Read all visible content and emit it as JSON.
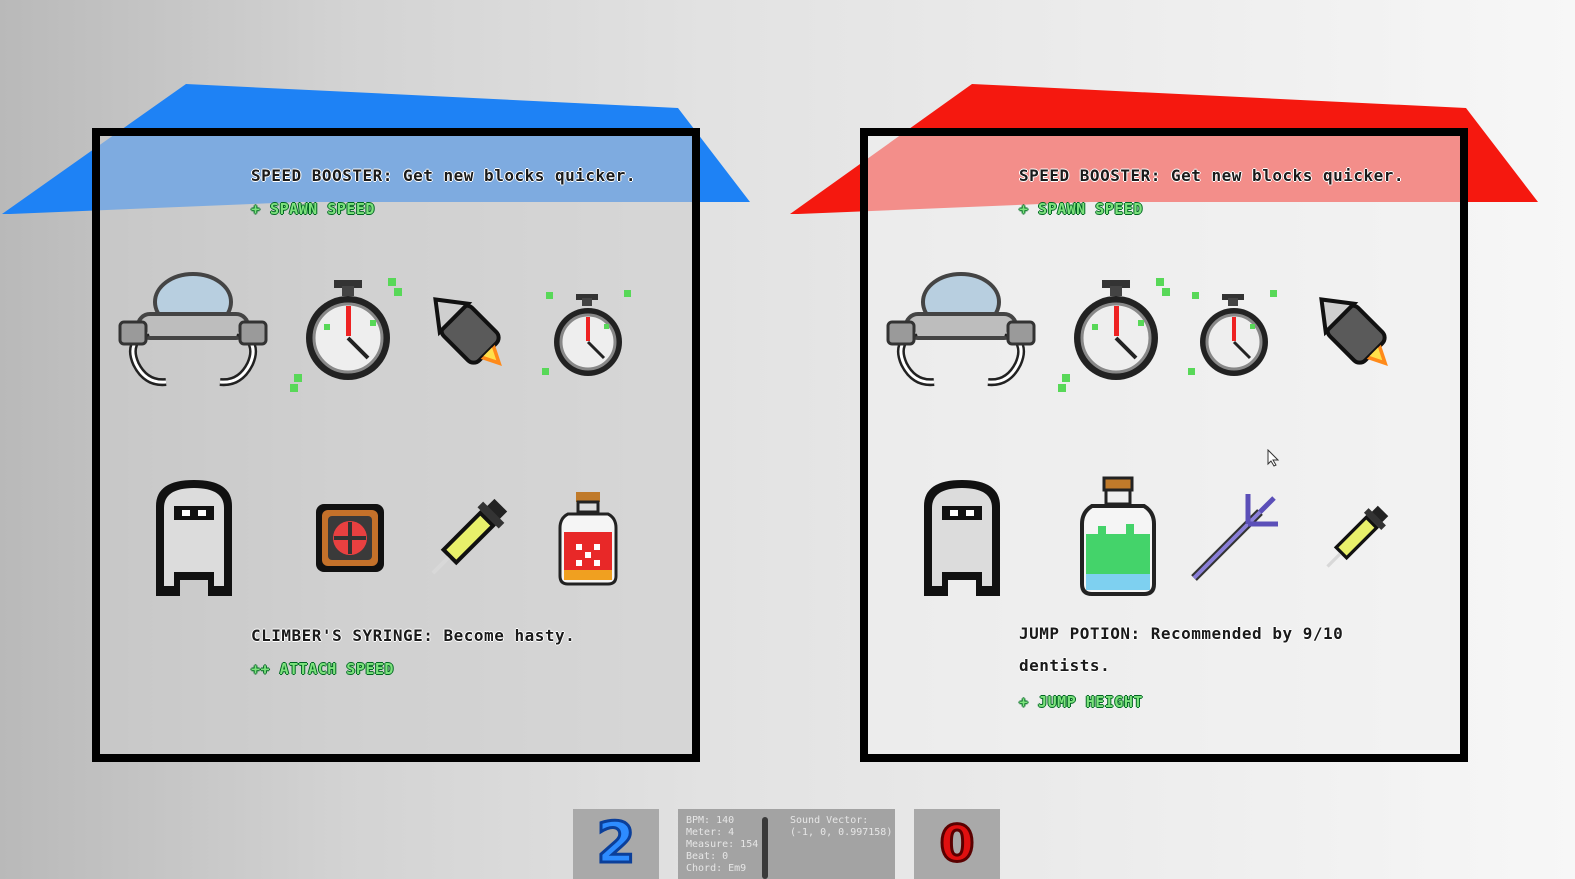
{
  "panels": [
    {
      "id": "player-blue",
      "accent": "#1e82f5",
      "top_item": {
        "name": "SPEED BOOSTER: Get new blocks quicker.",
        "stat": "+ SPAWN SPEED"
      },
      "row1_icons": [
        "ufo-icon",
        "stopwatch-icon",
        "rocket-icon",
        "small-stopwatch-icon"
      ],
      "row2_icons": [
        "hooded-ghost-icon",
        "framed-orb-icon",
        "syringe-icon",
        "red-potion-icon"
      ],
      "bottom_item": {
        "name": "CLIMBER'S SYRINGE: Become hasty.",
        "stat": "++ ATTACH SPEED"
      }
    },
    {
      "id": "player-red",
      "accent": "#f5180f",
      "top_item": {
        "name": "SPEED BOOSTER: Get new blocks quicker.",
        "stat": "+ SPAWN SPEED"
      },
      "row1_icons": [
        "ufo-icon",
        "stopwatch-icon",
        "small-stopwatch-icon",
        "rocket-icon"
      ],
      "row2_icons": [
        "hooded-ghost-icon",
        "green-potion-icon",
        "trident-icon",
        "syringe-icon"
      ],
      "bottom_item": {
        "name": "JUMP POTION: Recommended by 9/10 dentists.",
        "stat": "+ JUMP HEIGHT"
      }
    }
  ],
  "bottom_bar": {
    "left_key": "2",
    "left_key_color": "#1e82f5",
    "right_key": "0",
    "right_key_color": "#e01010",
    "debug": {
      "bpm": "BPM: 140",
      "meter": "Meter: 4",
      "measure": "Measure: 154",
      "beat": "Beat: 0",
      "chord": "Chord: Em9",
      "sound_vector_label": "Sound Vector:",
      "sound_vector_value": "(-1, 0, 0.997158)"
    }
  }
}
